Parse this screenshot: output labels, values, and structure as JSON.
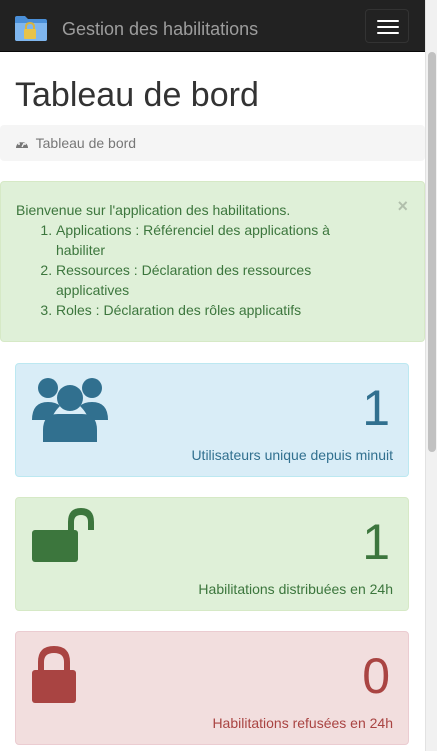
{
  "navbar": {
    "brand": "Gestion des habilitations",
    "logo_icon": "folder-lock-icon",
    "toggle_icon": "hamburger-menu-icon"
  },
  "page": {
    "title": "Tableau de bord",
    "breadcrumb": {
      "icon": "dashboard-icon",
      "label": "Tableau de bord"
    }
  },
  "alert": {
    "intro": "Bienvenue sur l'application des habilitations.",
    "close_label": "×",
    "items": [
      "Applications : Référenciel des applications à habiliter",
      "Ressources : Déclaration des ressources applicatives",
      "Roles : Déclaration des rôles applicatifs"
    ]
  },
  "stats": [
    {
      "icon": "users-icon",
      "value": "1",
      "label": "Utilisateurs unique depuis minuit",
      "color": "#31708f"
    },
    {
      "icon": "unlock-icon",
      "value": "1",
      "label": "Habilitations distribuées en 24h",
      "color": "#3c763d"
    },
    {
      "icon": "lock-icon",
      "value": "0",
      "label": "Habilitations refusées en 24h",
      "color": "#a94442"
    }
  ],
  "colors": {
    "navbar_bg": "#222222",
    "info_bg": "#d9edf7",
    "success_bg": "#dff0d8",
    "danger_bg": "#f2dede"
  }
}
